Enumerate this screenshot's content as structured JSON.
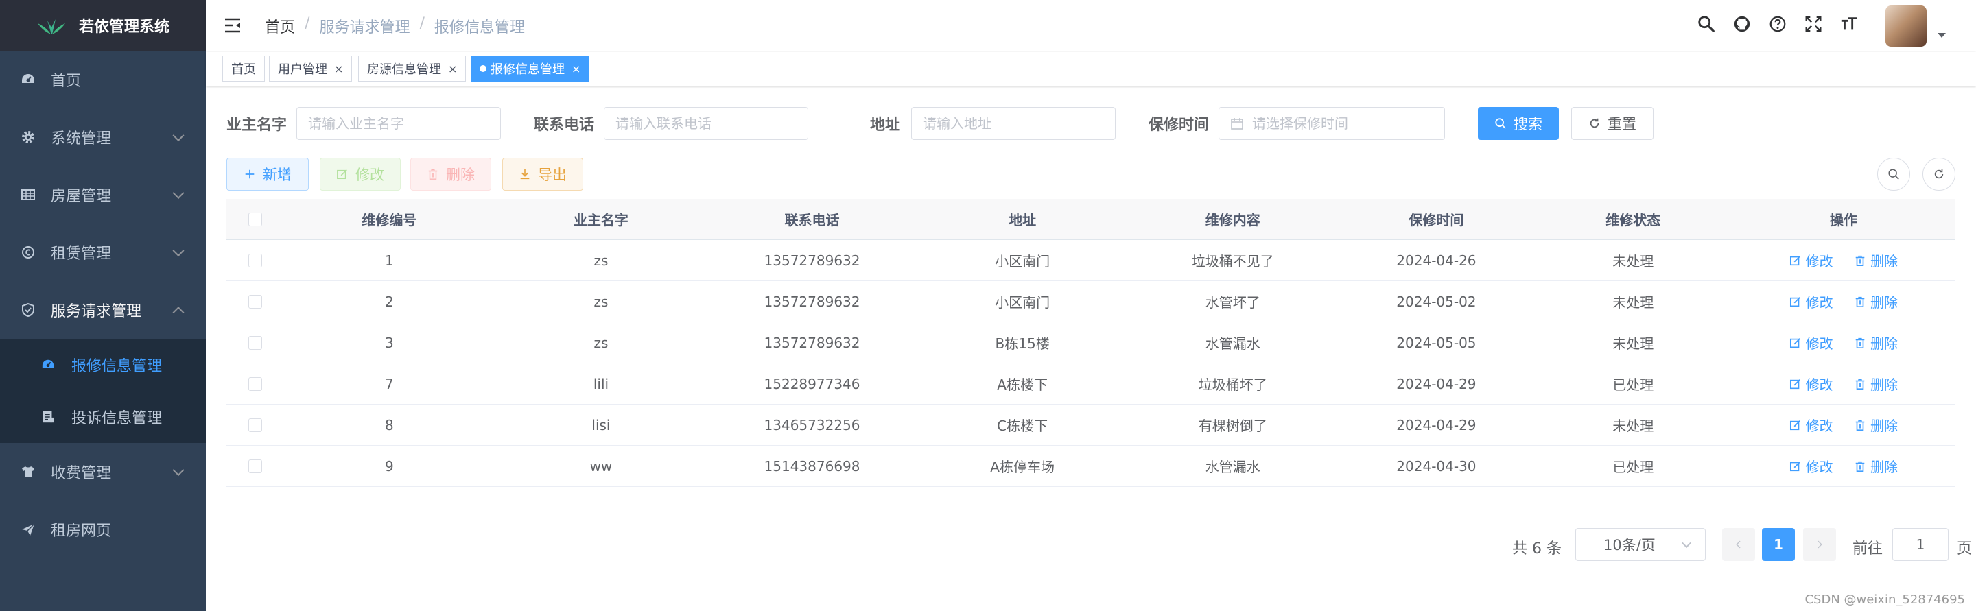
{
  "app": {
    "title": "若依管理系统"
  },
  "sidebar": {
    "items": [
      {
        "label": "首页",
        "icon": "dashboard-icon"
      },
      {
        "label": "系统管理",
        "icon": "gear-icon"
      },
      {
        "label": "房屋管理",
        "icon": "grid-icon"
      },
      {
        "label": "租赁管理",
        "icon": "coin-icon"
      },
      {
        "label": "服务请求管理",
        "icon": "shield-icon"
      },
      {
        "label": "收费管理",
        "icon": "shirt-icon"
      },
      {
        "label": "租房网页",
        "icon": "send-icon"
      }
    ],
    "submenu": [
      {
        "label": "报修信息管理",
        "icon": "dashboard-icon"
      },
      {
        "label": "投诉信息管理",
        "icon": "document-icon"
      }
    ]
  },
  "navbar": {
    "breadcrumb": [
      "首页",
      "服务请求管理",
      "报修信息管理"
    ],
    "breadcrumb_sep": "/"
  },
  "tags": [
    {
      "label": "首页"
    },
    {
      "label": "用户管理"
    },
    {
      "label": "房源信息管理"
    },
    {
      "label": "报修信息管理"
    }
  ],
  "tag_close": "×",
  "form": {
    "owner_label": "业主名字",
    "owner_placeholder": "请输入业主名字",
    "phone_label": "联系电话",
    "phone_placeholder": "请输入联系电话",
    "address_label": "地址",
    "address_placeholder": "请输入地址",
    "time_label": "保修时间",
    "time_placeholder": "请选择保修时间",
    "search_button": "搜索",
    "reset_button": "重置"
  },
  "toolbar": {
    "add": "新增",
    "edit": "修改",
    "delete": "删除",
    "export": "导出"
  },
  "table": {
    "columns": [
      "维修编号",
      "业主名字",
      "联系电话",
      "地址",
      "维修内容",
      "保修时间",
      "维修状态",
      "操作"
    ],
    "rows": [
      {
        "id": "1",
        "owner": "zs",
        "phone": "13572789632",
        "address": "小区南门",
        "content": "垃圾桶不见了",
        "time": "2024-04-26",
        "status": "未处理"
      },
      {
        "id": "2",
        "owner": "zs",
        "phone": "13572789632",
        "address": "小区南门",
        "content": "水管坏了",
        "time": "2024-05-02",
        "status": "未处理"
      },
      {
        "id": "3",
        "owner": "zs",
        "phone": "13572789632",
        "address": "B栋15楼",
        "content": "水管漏水",
        "time": "2024-05-05",
        "status": "未处理"
      },
      {
        "id": "7",
        "owner": "lili",
        "phone": "15228977346",
        "address": "A栋楼下",
        "content": "垃圾桶坏了",
        "time": "2024-04-29",
        "status": "已处理"
      },
      {
        "id": "8",
        "owner": "lisi",
        "phone": "13465732256",
        "address": "C栋楼下",
        "content": "有棵树倒了",
        "time": "2024-04-29",
        "status": "未处理"
      },
      {
        "id": "9",
        "owner": "ww",
        "phone": "15143876698",
        "address": "A栋停车场",
        "content": "水管漏水",
        "time": "2024-04-30",
        "status": "已处理"
      }
    ],
    "op_edit": "修改",
    "op_delete": "删除"
  },
  "pagination": {
    "total": "共 6 条",
    "page_size": "10条/页",
    "current_page": "1",
    "goto_label": "前往",
    "goto_value": "1",
    "page_suffix": "页"
  },
  "watermark": "CSDN @weixin_52874695",
  "colors": {
    "primary": "#409eff",
    "sidebar_bg": "#304156",
    "submenu_bg": "#1f2d3d"
  }
}
